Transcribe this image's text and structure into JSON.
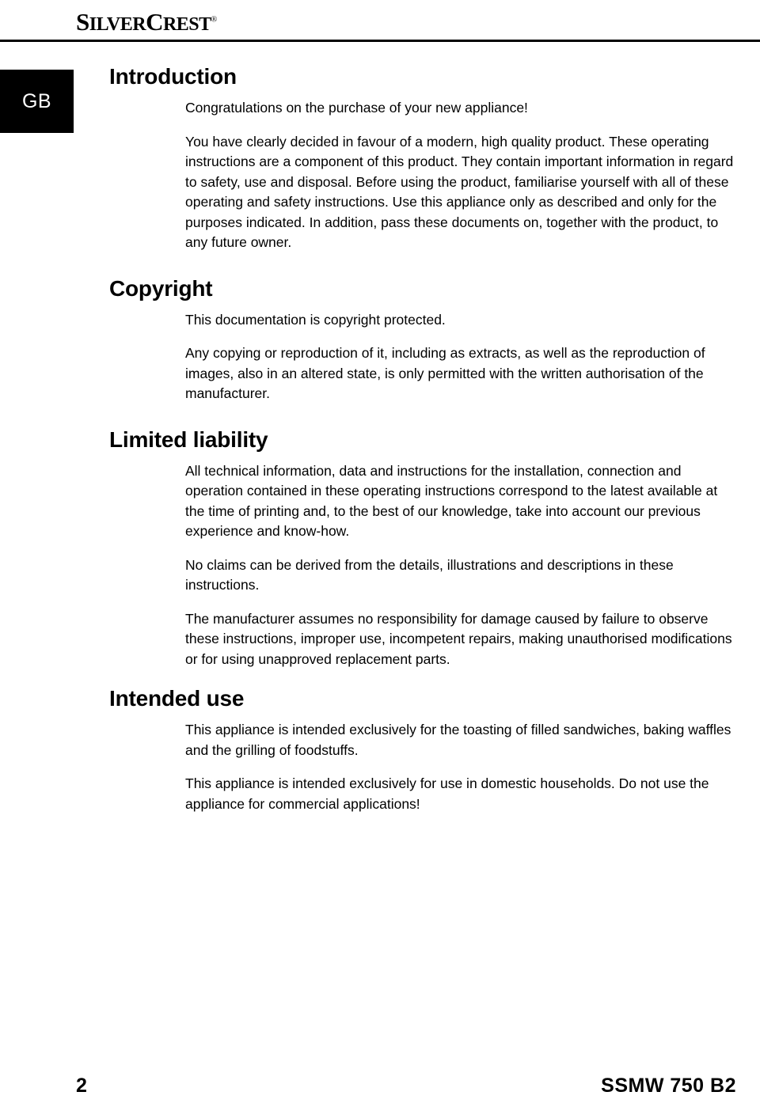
{
  "header": {
    "brand_part1": "S",
    "brand_part2": "ILVER",
    "brand_part3": "C",
    "brand_part4": "REST",
    "brand_registered": "®"
  },
  "country_tab": {
    "label": "GB"
  },
  "sections": [
    {
      "title": "Introduction",
      "paragraphs": [
        "Congratulations on the purchase of your new appliance!",
        "You have clearly decided in favour of a modern, high quality product. These operating instructions are a component of this product. They contain important information in regard to safety, use and disposal. Before using the product, familiarise yourself with all of these operating and safety instructions. Use this appliance only as described and only for the purposes indicated. In addition, pass these documents on, together with the product, to any future owner."
      ]
    },
    {
      "title": "Copyright",
      "paragraphs": [
        "This documentation is copyright protected.",
        "Any copying or reproduction of it, including as extracts, as well as the reproduction of images, also in an altered state, is only permitted with the written authorisation of the manufacturer."
      ]
    },
    {
      "title": "Limited liability",
      "paragraphs": [
        "All technical information, data and instructions for the installation, connection and operation contained in these operating instructions correspond to the latest available at the time of printing and, to the best of our knowledge, take into account our previous experience and know-how.",
        "No claims can be derived from the details, illustrations and descriptions in these instructions.",
        "The manufacturer assumes no responsibility for damage caused by failure to observe these instructions, improper use, incompetent repairs, making unauthorised modifications or for using unapproved replacement parts."
      ]
    },
    {
      "title": "Intended use",
      "paragraphs": [
        "This appliance is intended exclusively for the toasting of filled sandwiches, baking waffles and the grilling of foodstuffs.",
        "This appliance is intended exclusively for use in domestic households. Do not use the appliance for commercial applications!"
      ]
    }
  ],
  "footer": {
    "page_number": "2",
    "model": "SSMW 750 B2"
  }
}
